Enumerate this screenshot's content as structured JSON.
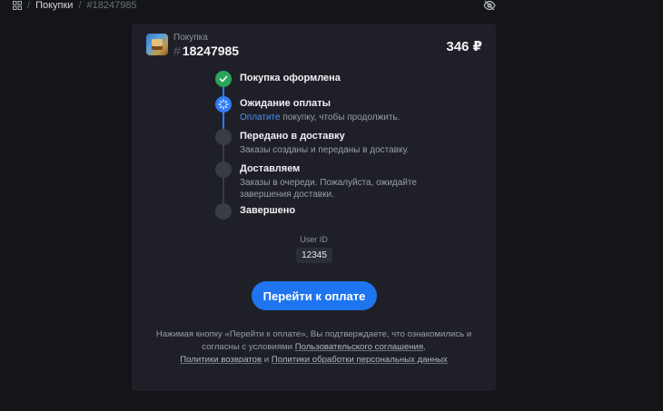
{
  "breadcrumb": {
    "purchases": "Покупки",
    "separator": "/",
    "current": "#18247985"
  },
  "order": {
    "label": "Покупка",
    "hash": "#",
    "number": "18247985",
    "price": "346 ₽"
  },
  "steps": [
    {
      "title": "Покупка оформлена",
      "desc_link": "",
      "desc": "",
      "state": "done"
    },
    {
      "title": "Ожидание оплаты",
      "desc_link": "Оплатите",
      "desc": " покупку, чтобы продолжить.",
      "state": "current"
    },
    {
      "title": "Передано в доставку",
      "desc_link": "",
      "desc": "Заказы созданы и переданы в доставку.",
      "state": "pending"
    },
    {
      "title": "Доставляем",
      "desc_link": "",
      "desc": "Заказы в очереди. Пожалуйста, ожидайте завершения доставки.",
      "state": "pending"
    },
    {
      "title": "Завершено",
      "desc_link": "",
      "desc": "",
      "state": "pending"
    }
  ],
  "user": {
    "label": "User ID",
    "id": "12345"
  },
  "pay_button": "Перейти к оплате",
  "legal": {
    "part1": "Нажимая кнопку «Перейти к оплате», Вы подтверждаете, что ознакомились и согласны с условиями ",
    "terms": "Пользовательского соглашения",
    "part2": ", ",
    "refund": "Политики возвратов",
    "part3": " и ",
    "privacy": "Политики обработки персональных данных"
  },
  "colors": {
    "accent": "#1f74f0",
    "done": "#2aa55a",
    "card": "#1f2027",
    "background": "#141519"
  }
}
